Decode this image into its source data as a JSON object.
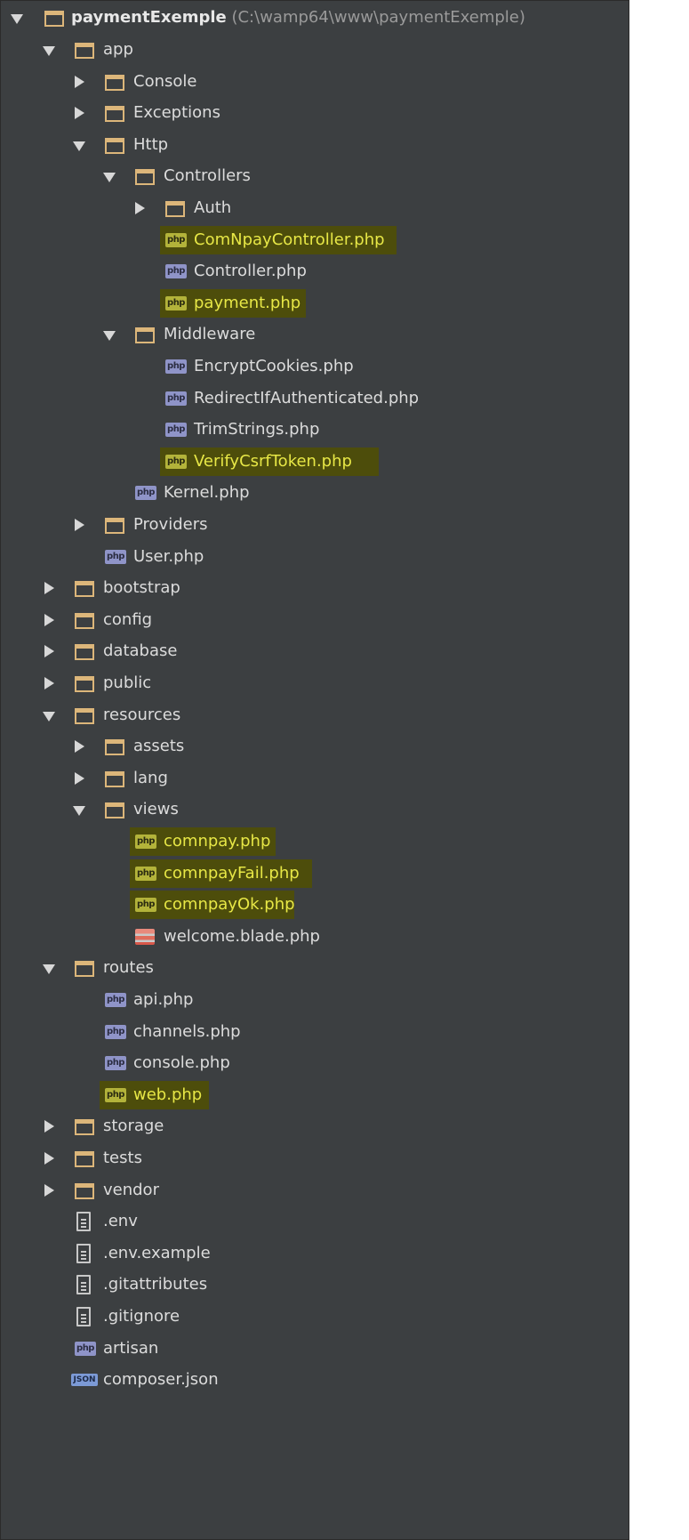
{
  "tree": {
    "root": {
      "name": "paymentExemple",
      "path": "(C:\\wamp64\\www\\paymentExemple)"
    },
    "items": [
      {
        "label": "app",
        "type": "folder",
        "state": "expanded",
        "depth": 1
      },
      {
        "label": "Console",
        "type": "folder",
        "state": "collapsed",
        "depth": 2
      },
      {
        "label": "Exceptions",
        "type": "folder",
        "state": "collapsed",
        "depth": 2
      },
      {
        "label": "Http",
        "type": "folder",
        "state": "expanded",
        "depth": 2
      },
      {
        "label": "Controllers",
        "type": "folder",
        "state": "expanded",
        "depth": 3
      },
      {
        "label": "Auth",
        "type": "folder",
        "state": "collapsed",
        "depth": 4
      },
      {
        "label": "ComNpayController.php",
        "type": "php",
        "highlighted": true,
        "depth": 4
      },
      {
        "label": "Controller.php",
        "type": "php",
        "depth": 4
      },
      {
        "label": "payment.php",
        "type": "php",
        "highlighted": true,
        "depth": 4
      },
      {
        "label": "Middleware",
        "type": "folder",
        "state": "expanded",
        "depth": 3
      },
      {
        "label": "EncryptCookies.php",
        "type": "php",
        "depth": 4
      },
      {
        "label": "RedirectIfAuthenticated.php",
        "type": "php",
        "depth": 4
      },
      {
        "label": "TrimStrings.php",
        "type": "php",
        "depth": 4
      },
      {
        "label": "VerifyCsrfToken.php",
        "type": "php",
        "highlighted": true,
        "depth": 4
      },
      {
        "label": "Kernel.php",
        "type": "php",
        "depth": 3
      },
      {
        "label": "Providers",
        "type": "folder",
        "state": "collapsed",
        "depth": 2
      },
      {
        "label": "User.php",
        "type": "php",
        "depth": 2
      },
      {
        "label": "bootstrap",
        "type": "folder",
        "state": "collapsed",
        "depth": 1
      },
      {
        "label": "config",
        "type": "folder",
        "state": "collapsed",
        "depth": 1
      },
      {
        "label": "database",
        "type": "folder",
        "state": "collapsed",
        "depth": 1
      },
      {
        "label": "public",
        "type": "folder",
        "state": "collapsed",
        "depth": 1
      },
      {
        "label": "resources",
        "type": "folder",
        "state": "expanded",
        "depth": 1
      },
      {
        "label": "assets",
        "type": "folder",
        "state": "collapsed",
        "depth": 2
      },
      {
        "label": "lang",
        "type": "folder",
        "state": "collapsed",
        "depth": 2
      },
      {
        "label": "views",
        "type": "folder",
        "state": "expanded",
        "depth": 2
      },
      {
        "label": "comnpay.php",
        "type": "php",
        "highlighted": true,
        "depth": 3
      },
      {
        "label": "comnpayFail.php",
        "type": "php",
        "highlighted": true,
        "depth": 3
      },
      {
        "label": "comnpayOk.php",
        "type": "php",
        "highlighted": true,
        "depth": 3
      },
      {
        "label": "welcome.blade.php",
        "type": "blade",
        "depth": 3
      },
      {
        "label": "routes",
        "type": "folder",
        "state": "expanded",
        "depth": 1
      },
      {
        "label": "api.php",
        "type": "php",
        "depth": 2
      },
      {
        "label": "channels.php",
        "type": "php",
        "depth": 2
      },
      {
        "label": "console.php",
        "type": "php",
        "depth": 2
      },
      {
        "label": "web.php",
        "type": "php",
        "highlighted": true,
        "depth": 2
      },
      {
        "label": "storage",
        "type": "folder",
        "state": "collapsed",
        "depth": 1
      },
      {
        "label": "tests",
        "type": "folder",
        "state": "collapsed",
        "depth": 1
      },
      {
        "label": "vendor",
        "type": "folder",
        "state": "collapsed",
        "depth": 1
      },
      {
        "label": ".env",
        "type": "text",
        "depth": 1
      },
      {
        "label": ".env.example",
        "type": "text",
        "depth": 1
      },
      {
        "label": ".gitattributes",
        "type": "text",
        "depth": 1
      },
      {
        "label": ".gitignore",
        "type": "text",
        "depth": 1
      },
      {
        "label": "artisan",
        "type": "php",
        "depth": 1
      },
      {
        "label": "composer.json",
        "type": "json",
        "depth": 1
      }
    ]
  },
  "icons": {
    "php": "php-file-icon",
    "folder": "folder-icon",
    "blade": "blade-file-icon",
    "text": "text-file-icon",
    "json": "json-file-icon",
    "php_badge": "php",
    "json_badge": "JSON"
  },
  "colors": {
    "background": "#3c3f41",
    "highlight": "#4d4d0b",
    "highlight_text": "#e7e746",
    "text": "#dcdcdc",
    "folder": "#dcb67a"
  }
}
